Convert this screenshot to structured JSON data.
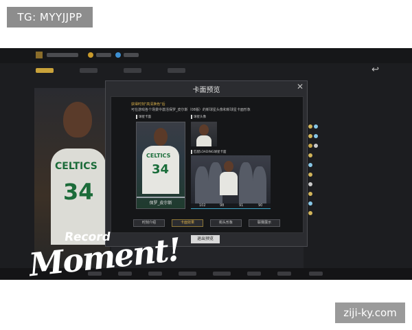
{
  "overlay": {
    "tg": "TG: MYYJJPP",
    "site": "ziji-ky.com"
  },
  "modal": {
    "title": "卡面预览",
    "close_icon": "close-icon",
    "notice_gold": "获得时刻\"高清换色\"后",
    "notice_line2": "可在游戏各个场景中激活保罗_皮尔斯（08版）的新球星头像和新球星卡面形象",
    "labels": {
      "card": "球星卡面",
      "avatar": "球星头像",
      "loading": "匹配LOADING球星卡面"
    },
    "card": {
      "name": "保罗_皮尔斯",
      "jersey_team": "CELTICS",
      "jersey_number": "34"
    },
    "loading_stats": [
      "102",
      "98",
      "91",
      "90"
    ],
    "tabs": [
      "时刻介绍",
      "卡面效果",
      "街头形象",
      "联赛展示"
    ],
    "active_tab": 1,
    "exit_button": "退出预览"
  },
  "background": {
    "jersey_team": "CELTICS",
    "jersey_number": "34"
  },
  "brand": {
    "line1": "Record",
    "line2": "Moment!"
  },
  "colors": {
    "gold": "#d9b04a",
    "accent_blue": "#3aa7c9",
    "modal_bg": "#2b2c30"
  }
}
